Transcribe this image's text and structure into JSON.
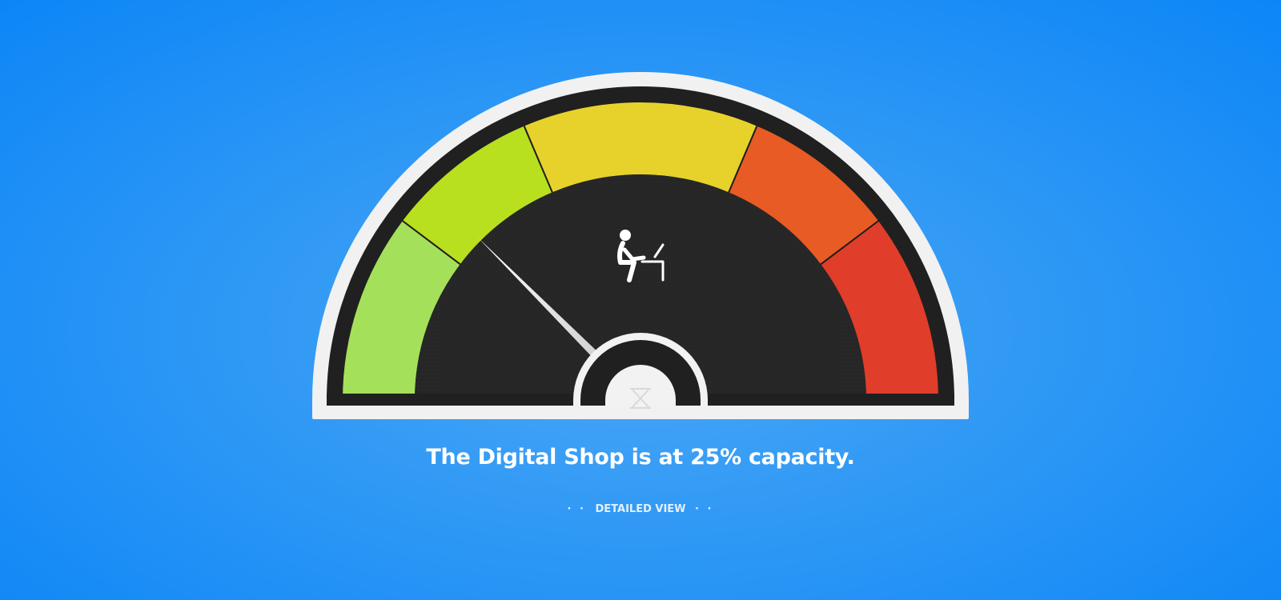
{
  "gauge": {
    "level_fraction": 0.25,
    "zones": [
      {
        "color": "#a5e05a"
      },
      {
        "color": "#b8e01f"
      },
      {
        "color": "#e7d22b"
      },
      {
        "color": "#e85b24"
      },
      {
        "color": "#e03d2b"
      }
    ],
    "colors": {
      "outer_rim": "#f1f1f1",
      "dark_ring": "#202020",
      "inner_face": "#262626",
      "hub": "#f2f2f2",
      "needle": "#ffffff"
    },
    "center_icon": "person-at-desk-icon",
    "hub_icon": "hourglass-icon"
  },
  "status": {
    "shop_name": "The Digital Shop",
    "text_before": " is at ",
    "percent": "25%",
    "text_after": " capacity."
  },
  "detail_link": {
    "dots_left": "· · ",
    "label": "DETAILED VIEW",
    "dots_right": " · ·"
  }
}
